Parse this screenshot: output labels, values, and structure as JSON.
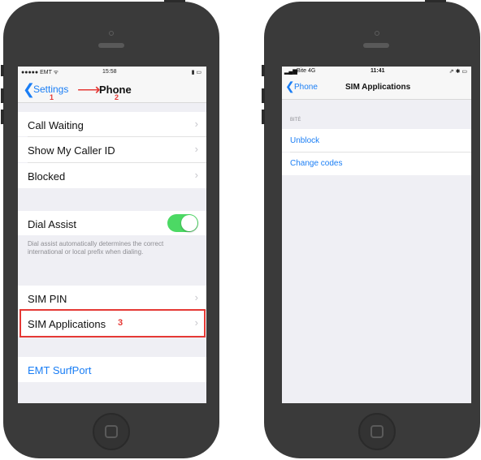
{
  "left_phone": {
    "status": {
      "carrier": "●●●●● EMT ᯤ",
      "time": "15:58",
      "battery": "▮ ▭"
    },
    "nav": {
      "back_label": "Settings",
      "title": "Phone",
      "step_back": "1",
      "step_title": "2"
    },
    "rows": {
      "call_waiting": "Call Waiting",
      "show_caller_id": "Show My Caller ID",
      "blocked": "Blocked",
      "dial_assist": "Dial Assist",
      "dial_assist_footnote": "Dial assist automatically determines the correct international or local prefix when dialing.",
      "sim_pin": "SIM PIN",
      "sim_applications": "SIM Applications",
      "step_sim_apps": "3",
      "emt_surfport": "EMT SurfPort"
    },
    "dial_assist_on": true,
    "chevron": "›"
  },
  "right_phone": {
    "status": {
      "carrier": "Bite 4G",
      "time": "11:41",
      "icons": "⇗ ✱ ▭"
    },
    "nav": {
      "back_label": "Phone",
      "title": "SIM Applications"
    },
    "section_header": "BITĖ",
    "rows": {
      "unblock": "Unblock",
      "change_codes": "Change codes"
    }
  },
  "colors": {
    "accent": "#1a7ef5",
    "annotation": "#e53935",
    "toggle_on": "#4cd964",
    "phone_body": "#3a3a3a"
  }
}
